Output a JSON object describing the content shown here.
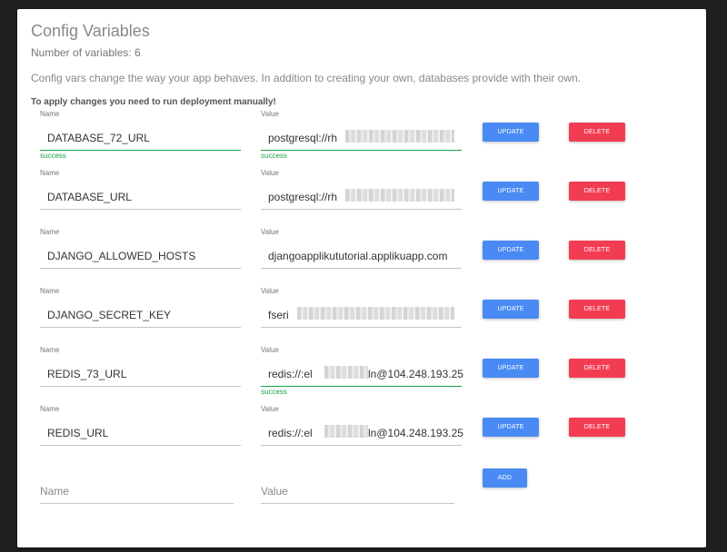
{
  "page": {
    "title": "Config Variables",
    "count_text": "Number of variables: 6",
    "description": "Config vars change the way your app behaves. In addition to creating your own, databases provide with their own.",
    "warning": "To apply changes you need to run deployment manually!"
  },
  "labels": {
    "name": "Name",
    "value": "Value",
    "success": "success"
  },
  "buttons": {
    "update": "UPDATE",
    "delete": "DELETE",
    "add": "ADD"
  },
  "variables": [
    {
      "name": "DATABASE_72_URL",
      "value": "postgresql://rh",
      "name_success": true,
      "value_success": true,
      "masked": true
    },
    {
      "name": "DATABASE_URL",
      "value": "postgresql://rh",
      "name_success": false,
      "value_success": false,
      "masked": true
    },
    {
      "name": "DJANGO_ALLOWED_HOSTS",
      "value": "djangoapplikututorial.applikuapp.com",
      "name_success": false,
      "value_success": false,
      "masked": false
    },
    {
      "name": "DJANGO_SECRET_KEY",
      "value": "fseri",
      "name_success": false,
      "value_success": false,
      "masked": true
    },
    {
      "name": "REDIS_73_URL",
      "value": "redis://:el",
      "value_suffix": "ln@104.248.193.25",
      "name_success": false,
      "value_success": true,
      "masked": true
    },
    {
      "name": "REDIS_URL",
      "value": "redis://:el",
      "value_suffix": "ln@104.248.193.25",
      "name_success": false,
      "value_success": false,
      "masked": true
    }
  ],
  "new_variable": {
    "name_placeholder": "Name",
    "value_placeholder": "Value"
  },
  "colors": {
    "primary": "#4a8af4",
    "danger": "#f23c52",
    "success": "#1aa34a"
  }
}
